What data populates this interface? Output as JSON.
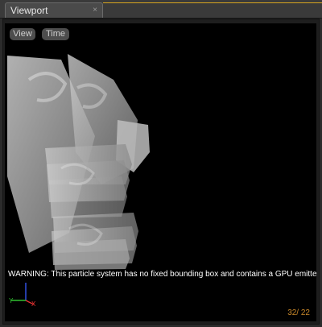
{
  "tab": {
    "title": "Viewport",
    "close_glyph": "×"
  },
  "viewport": {
    "buttons": {
      "view_label": "View",
      "time_label": "Time"
    },
    "warning_text": "WARNING: This particle system has no fixed bounding box and contains a GPU emitter.",
    "frame_counter": "32/ 22",
    "axis_gizmo": {
      "x_color": "#e03030",
      "y_color": "#30c030",
      "z_color": "#3050e0"
    },
    "background_color": "#000000",
    "accent_color": "#d7a521",
    "counter_color": "#c9882a"
  }
}
